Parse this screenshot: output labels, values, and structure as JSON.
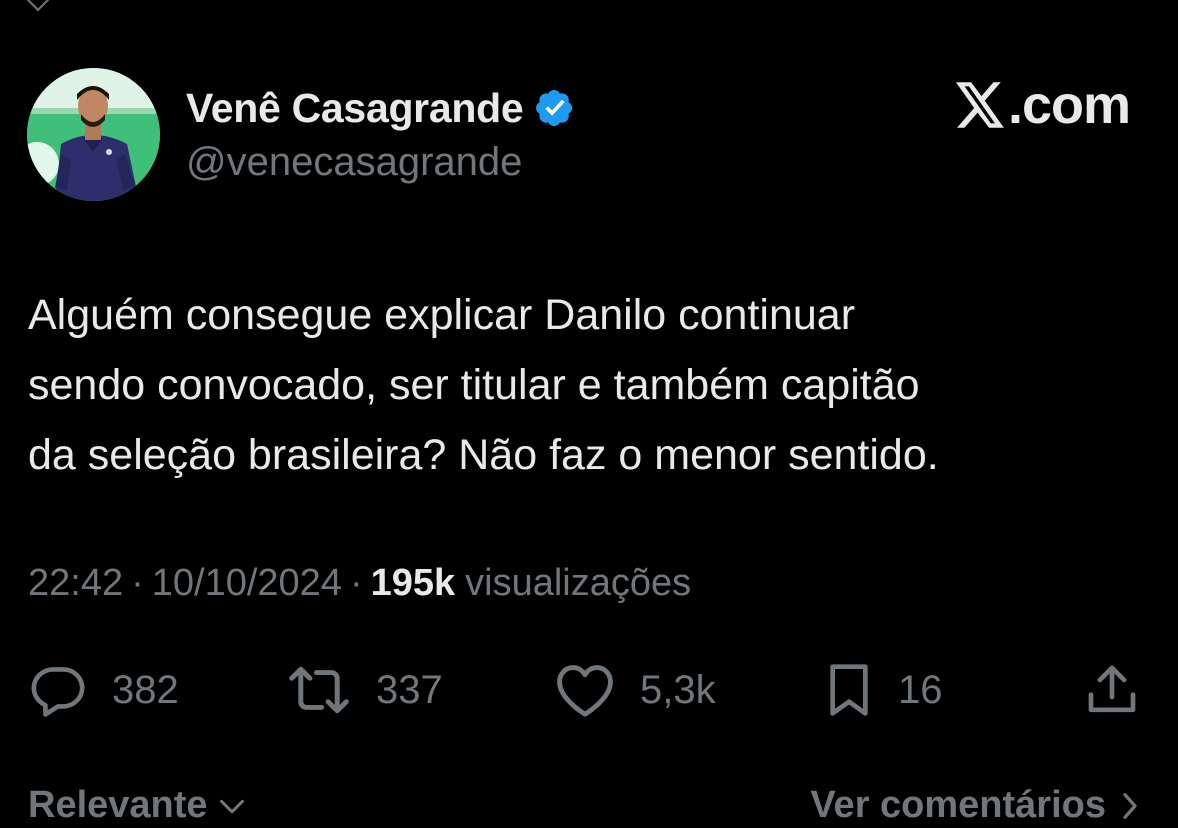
{
  "author": {
    "display_name": "Venê Casagrande",
    "handle": "@venecasagrande",
    "verified_icon": "verified-badge-icon",
    "avatar_icon": "avatar-photo"
  },
  "brand": {
    "logo_icon": "x-logo-icon",
    "text": ".com"
  },
  "tweet": {
    "text": "Alguém consegue explicar Danilo continuar\nsendo convocado, ser titular e também capitão\nda seleção brasileira? Não faz o menor sentido.",
    "time": "22:42",
    "date": "10/10/2024",
    "separator": "·",
    "views_count": "195k",
    "views_label": "visualizações"
  },
  "actions": {
    "reply": {
      "icon": "reply-icon",
      "count": "382"
    },
    "retweet": {
      "icon": "retweet-icon",
      "count": "337"
    },
    "like": {
      "icon": "heart-icon",
      "count": "5,3k"
    },
    "bookmark": {
      "icon": "bookmark-icon",
      "count": "16"
    },
    "share": {
      "icon": "share-icon"
    }
  },
  "bottom_bar": {
    "sort_label": "Relevante",
    "sort_icon": "chevron-down-icon",
    "comments_label": "Ver comentários",
    "comments_icon": "chevron-right-icon"
  },
  "colors": {
    "background": "#000000",
    "primary_text": "#e7e9ea",
    "secondary_text": "#71767b",
    "verified_blue": "#1d9bf0"
  }
}
